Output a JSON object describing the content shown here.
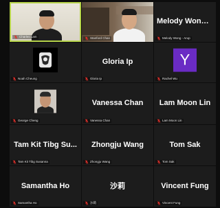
{
  "participants": [
    {
      "display": "",
      "label": "Charles Lam",
      "kind": "video-charles",
      "active": true
    },
    {
      "display": "",
      "label": "Stanford Chan",
      "kind": "video-stanford",
      "active": false
    },
    {
      "display": "Melody Wong -...",
      "label": "Melody Wong - Arup",
      "kind": "name",
      "active": false
    },
    {
      "display": "",
      "label": "Noah Cheung",
      "kind": "logo",
      "active": false
    },
    {
      "display": "Gloria Ip",
      "label": "Gloria Ip",
      "kind": "name",
      "active": false
    },
    {
      "display": "",
      "label": "Rachel Wu",
      "kind": "avatar-y",
      "avatar_letter": "Y",
      "active": false
    },
    {
      "display": "",
      "label": "George Cheng",
      "kind": "photo",
      "active": false
    },
    {
      "display": "Vanessa Chan",
      "label": "Vanessa Chan",
      "kind": "name",
      "active": false
    },
    {
      "display": "Lam Moon Lin",
      "label": "Lam Moon Lin",
      "kind": "name",
      "active": false
    },
    {
      "display": "Tam Kit Tibg Su...",
      "label": "Tam Kit Tibg Susanna",
      "kind": "name",
      "active": false
    },
    {
      "display": "Zhongju Wang",
      "label": "Zhongju Wang",
      "kind": "name",
      "active": false
    },
    {
      "display": "Tom Sak",
      "label": "Tom Sak",
      "kind": "name",
      "active": false
    },
    {
      "display": "Samantha Ho",
      "label": "Samantha Ho",
      "kind": "name",
      "active": false
    },
    {
      "display": "沙莉",
      "label": "沙莉",
      "kind": "name",
      "active": false
    },
    {
      "display": "Vincent Fung",
      "label": "Vincent Fung",
      "kind": "name",
      "active": false
    }
  ],
  "colors": {
    "tile_bg": "#1c1c1c",
    "active_border": "#b7d44b",
    "muted_mic": "#e0312b",
    "avatar_purple": "#6a2bc4"
  },
  "icons": {
    "mic": "muted-mic-icon"
  }
}
